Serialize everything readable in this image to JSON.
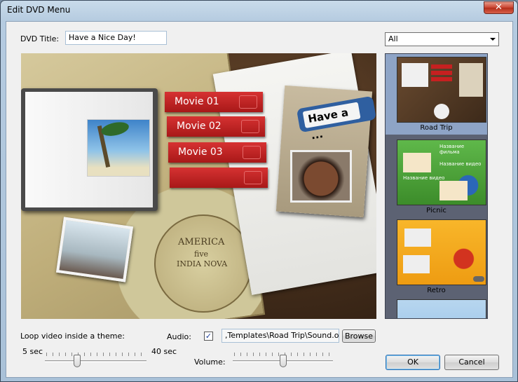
{
  "window": {
    "title": "Edit DVD Menu",
    "close_label": "✕"
  },
  "form": {
    "dvd_title_label": "DVD Title:",
    "dvd_title_value": "Have a Nice Day!",
    "filter_value": "All"
  },
  "preview": {
    "menu_items": [
      "Movie 01",
      "Movie 02",
      "Movie 03"
    ],
    "tag_text": "Have a ...",
    "map_text_1": "AMERICA",
    "map_text_2": "five",
    "map_text_3": "INDIA NOVA"
  },
  "themes": [
    {
      "name": "Road Trip",
      "selected": true
    },
    {
      "name": "Picnic",
      "selected": false
    },
    {
      "name": "Retro",
      "selected": false
    },
    {
      "name": "",
      "selected": false
    }
  ],
  "picnic_thumb_labels": [
    "Название фильма",
    "Название видео",
    "Название видео"
  ],
  "loop": {
    "label": "Loop video inside a theme:",
    "min_label": "5 sec",
    "max_label": "40 sec",
    "fraction": 0.3
  },
  "audio": {
    "label": "Audio:",
    "checked": true,
    "check_glyph": "✓",
    "path": ",Templates\\Road Trip\\Sound.ogg",
    "browse_label": "Browse",
    "volume_label": "Volume:",
    "volume_fraction": 0.5
  },
  "buttons": {
    "ok": "OK",
    "cancel": "Cancel"
  }
}
